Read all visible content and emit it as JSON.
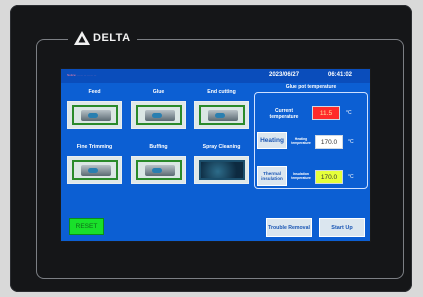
{
  "brand": {
    "name": "DELTA",
    "icon": "delta-logo-icon"
  },
  "topbar": {
    "marquee": "Notice: ... ... ... ... ... ...",
    "date": "2023/06/27",
    "time": "06:41:02"
  },
  "tiles": [
    {
      "label": "Feed"
    },
    {
      "label": "Glue"
    },
    {
      "label": "End cutting"
    },
    {
      "label": "Fine Trimming"
    },
    {
      "label": "Buffing"
    },
    {
      "label": "Spray Cleaning"
    }
  ],
  "glue_pot": {
    "title": "Glue pot temperature",
    "current_label": "Current temperature",
    "current_value": "11.5",
    "heating_button": "Heating",
    "heating_temp_label": "Heating temperature",
    "heating_value": "170.0",
    "thermal_button": "Thermal insulation",
    "insulation_temp_label": "Insulation temperature",
    "insulation_value": "170.0",
    "unit": "°C"
  },
  "buttons": {
    "reset": "RESET",
    "trouble_removal": "Trouble Removal",
    "start_up": "Start Up"
  },
  "colors": {
    "screen_bg": "#0c5fd3",
    "current_value_bg": "#ff2a2a",
    "insulation_value_bg": "#e6ff3a",
    "reset_bg": "#19e02a"
  }
}
